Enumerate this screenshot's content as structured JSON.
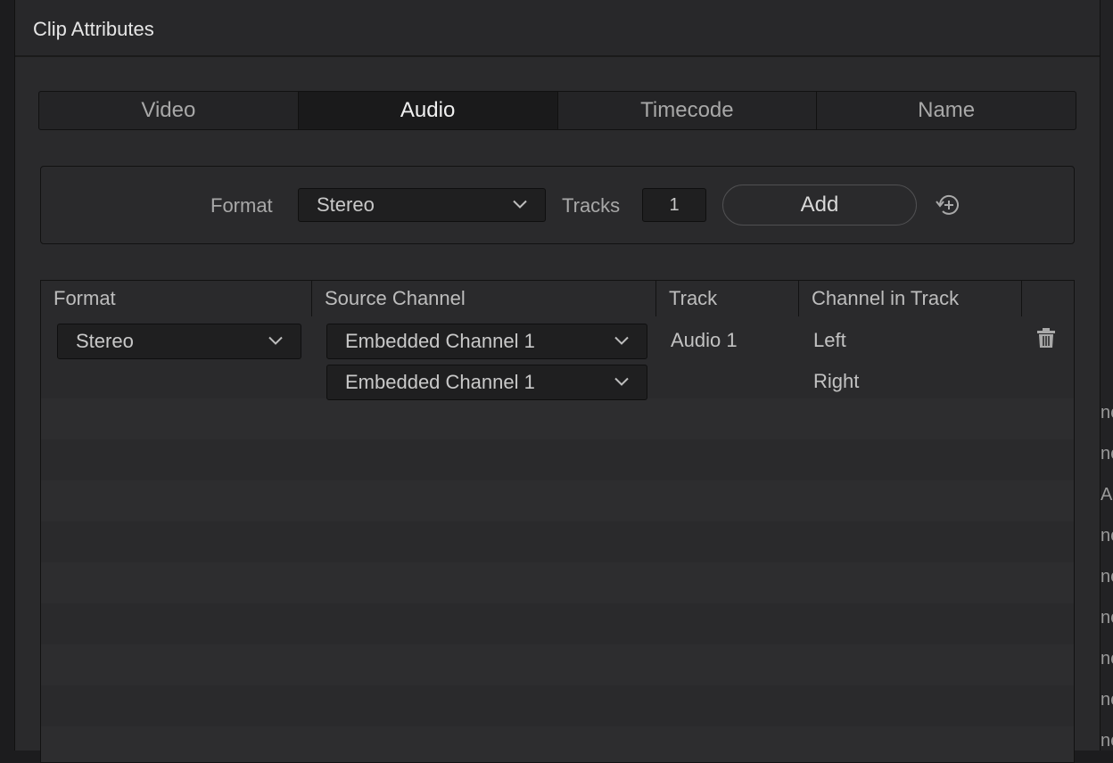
{
  "dialog": {
    "title": "Clip Attributes"
  },
  "tabs": [
    {
      "label": "Video",
      "active": false
    },
    {
      "label": "Audio",
      "active": true
    },
    {
      "label": "Timecode",
      "active": false
    },
    {
      "label": "Name",
      "active": false
    }
  ],
  "add_track": {
    "format_label": "Format",
    "format_value": "Stereo",
    "tracks_label": "Tracks",
    "tracks_value": "1",
    "add_label": "Add",
    "reset_icon": "reset-icon"
  },
  "table": {
    "headers": [
      "Format",
      "Source Channel",
      "Track",
      "Channel in Track"
    ],
    "rows": [
      {
        "format": "Stereo",
        "sources": [
          "Embedded Channel 1",
          "Embedded Channel 1"
        ],
        "track": "Audio 1",
        "channels": [
          "Left",
          "Right"
        ],
        "delete_icon": "trash-icon"
      }
    ]
  },
  "background_fragments": [
    "ne",
    "ne",
    "A",
    "ne",
    "ne",
    "ne",
    "ne",
    "ne",
    "ne"
  ],
  "colors": {
    "panel": "#2a2a2c",
    "field": "#1f1f20",
    "active_tab": "#1a1a1b",
    "text": "#c8c8c8"
  }
}
